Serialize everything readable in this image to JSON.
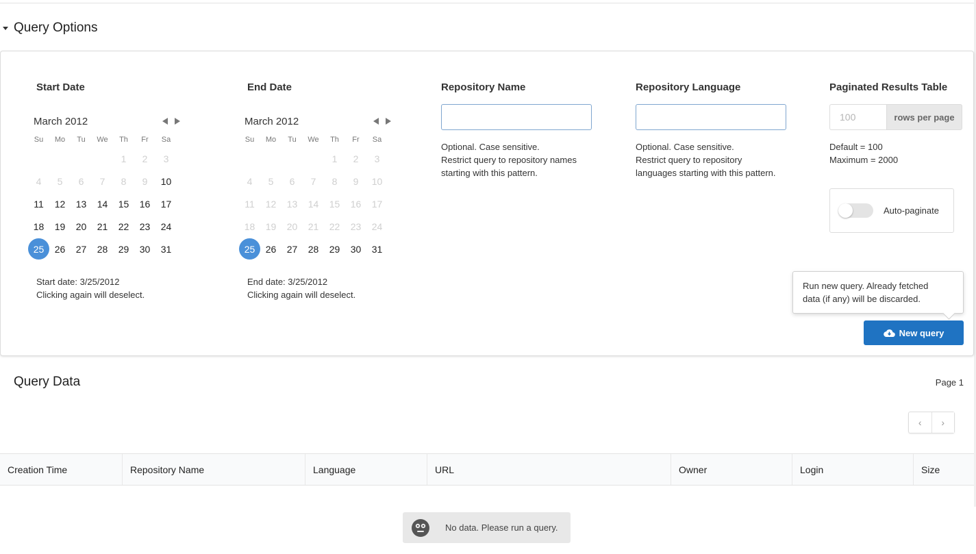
{
  "query_options": {
    "title": "Query Options",
    "start_date": {
      "label": "Start Date",
      "month": "March 2012",
      "weekdays": [
        "Su",
        "Mo",
        "Tu",
        "We",
        "Th",
        "Fr",
        "Sa"
      ],
      "selected_day": 25,
      "note_line1": "Start date: 3/25/2012",
      "note_line2": "Clicking again will deselect."
    },
    "end_date": {
      "label": "End Date",
      "month": "March 2012",
      "weekdays": [
        "Su",
        "Mo",
        "Tu",
        "We",
        "Th",
        "Fr",
        "Sa"
      ],
      "selected_day": 25,
      "note_line1": "End date: 3/25/2012",
      "note_line2": "Clicking again will deselect."
    },
    "repo_name": {
      "label": "Repository Name",
      "value": "",
      "help_line1": "Optional. Case sensitive.",
      "help_line2": "Restrict query to repository names",
      "help_line3": "starting with this pattern."
    },
    "repo_language": {
      "label": "Repository Language",
      "value": "",
      "help_line1": "Optional. Case sensitive.",
      "help_line2": "Restrict query to repository",
      "help_line3": "languages starting with this pattern."
    },
    "paginated": {
      "label": "Paginated Results Table",
      "rows_placeholder": "100",
      "rows_addon": "rows per page",
      "default_text": "Default = 100",
      "maximum_text": "Maximum = 2000",
      "auto_paginate_label": "Auto-paginate",
      "auto_paginate_on": false
    },
    "tooltip_line1": "Run new query. Already fetched",
    "tooltip_line2": "data (if any) will be discarded.",
    "new_query_label": "New query"
  },
  "query_data": {
    "title": "Query Data",
    "page_label": "Page 1",
    "prev_label": "‹",
    "next_label": "›",
    "columns": [
      "Creation Time",
      "Repository Name",
      "Language",
      "URL",
      "Owner",
      "Login",
      "Size"
    ],
    "empty_message": "No data. Please run a query."
  },
  "calendar_days": [
    [
      null,
      null,
      null,
      null,
      1,
      2,
      3
    ],
    [
      4,
      5,
      6,
      7,
      8,
      9,
      10
    ],
    [
      11,
      12,
      13,
      14,
      15,
      16,
      17
    ],
    [
      18,
      19,
      20,
      21,
      22,
      23,
      24
    ],
    [
      25,
      26,
      27,
      28,
      29,
      30,
      31
    ]
  ],
  "colors": {
    "accent": "#4a90d9",
    "primary_button": "#1f73c2"
  }
}
